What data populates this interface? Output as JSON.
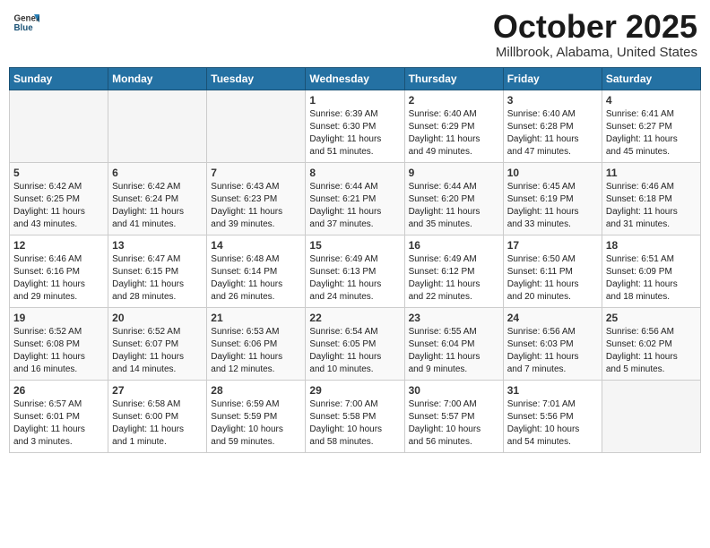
{
  "header": {
    "logo_general": "General",
    "logo_blue": "Blue",
    "month": "October 2025",
    "location": "Millbrook, Alabama, United States"
  },
  "days_of_week": [
    "Sunday",
    "Monday",
    "Tuesday",
    "Wednesday",
    "Thursday",
    "Friday",
    "Saturday"
  ],
  "weeks": [
    [
      {
        "day": "",
        "info": ""
      },
      {
        "day": "",
        "info": ""
      },
      {
        "day": "",
        "info": ""
      },
      {
        "day": "1",
        "info": "Sunrise: 6:39 AM\nSunset: 6:30 PM\nDaylight: 11 hours\nand 51 minutes."
      },
      {
        "day": "2",
        "info": "Sunrise: 6:40 AM\nSunset: 6:29 PM\nDaylight: 11 hours\nand 49 minutes."
      },
      {
        "day": "3",
        "info": "Sunrise: 6:40 AM\nSunset: 6:28 PM\nDaylight: 11 hours\nand 47 minutes."
      },
      {
        "day": "4",
        "info": "Sunrise: 6:41 AM\nSunset: 6:27 PM\nDaylight: 11 hours\nand 45 minutes."
      }
    ],
    [
      {
        "day": "5",
        "info": "Sunrise: 6:42 AM\nSunset: 6:25 PM\nDaylight: 11 hours\nand 43 minutes."
      },
      {
        "day": "6",
        "info": "Sunrise: 6:42 AM\nSunset: 6:24 PM\nDaylight: 11 hours\nand 41 minutes."
      },
      {
        "day": "7",
        "info": "Sunrise: 6:43 AM\nSunset: 6:23 PM\nDaylight: 11 hours\nand 39 minutes."
      },
      {
        "day": "8",
        "info": "Sunrise: 6:44 AM\nSunset: 6:21 PM\nDaylight: 11 hours\nand 37 minutes."
      },
      {
        "day": "9",
        "info": "Sunrise: 6:44 AM\nSunset: 6:20 PM\nDaylight: 11 hours\nand 35 minutes."
      },
      {
        "day": "10",
        "info": "Sunrise: 6:45 AM\nSunset: 6:19 PM\nDaylight: 11 hours\nand 33 minutes."
      },
      {
        "day": "11",
        "info": "Sunrise: 6:46 AM\nSunset: 6:18 PM\nDaylight: 11 hours\nand 31 minutes."
      }
    ],
    [
      {
        "day": "12",
        "info": "Sunrise: 6:46 AM\nSunset: 6:16 PM\nDaylight: 11 hours\nand 29 minutes."
      },
      {
        "day": "13",
        "info": "Sunrise: 6:47 AM\nSunset: 6:15 PM\nDaylight: 11 hours\nand 28 minutes."
      },
      {
        "day": "14",
        "info": "Sunrise: 6:48 AM\nSunset: 6:14 PM\nDaylight: 11 hours\nand 26 minutes."
      },
      {
        "day": "15",
        "info": "Sunrise: 6:49 AM\nSunset: 6:13 PM\nDaylight: 11 hours\nand 24 minutes."
      },
      {
        "day": "16",
        "info": "Sunrise: 6:49 AM\nSunset: 6:12 PM\nDaylight: 11 hours\nand 22 minutes."
      },
      {
        "day": "17",
        "info": "Sunrise: 6:50 AM\nSunset: 6:11 PM\nDaylight: 11 hours\nand 20 minutes."
      },
      {
        "day": "18",
        "info": "Sunrise: 6:51 AM\nSunset: 6:09 PM\nDaylight: 11 hours\nand 18 minutes."
      }
    ],
    [
      {
        "day": "19",
        "info": "Sunrise: 6:52 AM\nSunset: 6:08 PM\nDaylight: 11 hours\nand 16 minutes."
      },
      {
        "day": "20",
        "info": "Sunrise: 6:52 AM\nSunset: 6:07 PM\nDaylight: 11 hours\nand 14 minutes."
      },
      {
        "day": "21",
        "info": "Sunrise: 6:53 AM\nSunset: 6:06 PM\nDaylight: 11 hours\nand 12 minutes."
      },
      {
        "day": "22",
        "info": "Sunrise: 6:54 AM\nSunset: 6:05 PM\nDaylight: 11 hours\nand 10 minutes."
      },
      {
        "day": "23",
        "info": "Sunrise: 6:55 AM\nSunset: 6:04 PM\nDaylight: 11 hours\nand 9 minutes."
      },
      {
        "day": "24",
        "info": "Sunrise: 6:56 AM\nSunset: 6:03 PM\nDaylight: 11 hours\nand 7 minutes."
      },
      {
        "day": "25",
        "info": "Sunrise: 6:56 AM\nSunset: 6:02 PM\nDaylight: 11 hours\nand 5 minutes."
      }
    ],
    [
      {
        "day": "26",
        "info": "Sunrise: 6:57 AM\nSunset: 6:01 PM\nDaylight: 11 hours\nand 3 minutes."
      },
      {
        "day": "27",
        "info": "Sunrise: 6:58 AM\nSunset: 6:00 PM\nDaylight: 11 hours\nand 1 minute."
      },
      {
        "day": "28",
        "info": "Sunrise: 6:59 AM\nSunset: 5:59 PM\nDaylight: 10 hours\nand 59 minutes."
      },
      {
        "day": "29",
        "info": "Sunrise: 7:00 AM\nSunset: 5:58 PM\nDaylight: 10 hours\nand 58 minutes."
      },
      {
        "day": "30",
        "info": "Sunrise: 7:00 AM\nSunset: 5:57 PM\nDaylight: 10 hours\nand 56 minutes."
      },
      {
        "day": "31",
        "info": "Sunrise: 7:01 AM\nSunset: 5:56 PM\nDaylight: 10 hours\nand 54 minutes."
      },
      {
        "day": "",
        "info": ""
      }
    ]
  ]
}
